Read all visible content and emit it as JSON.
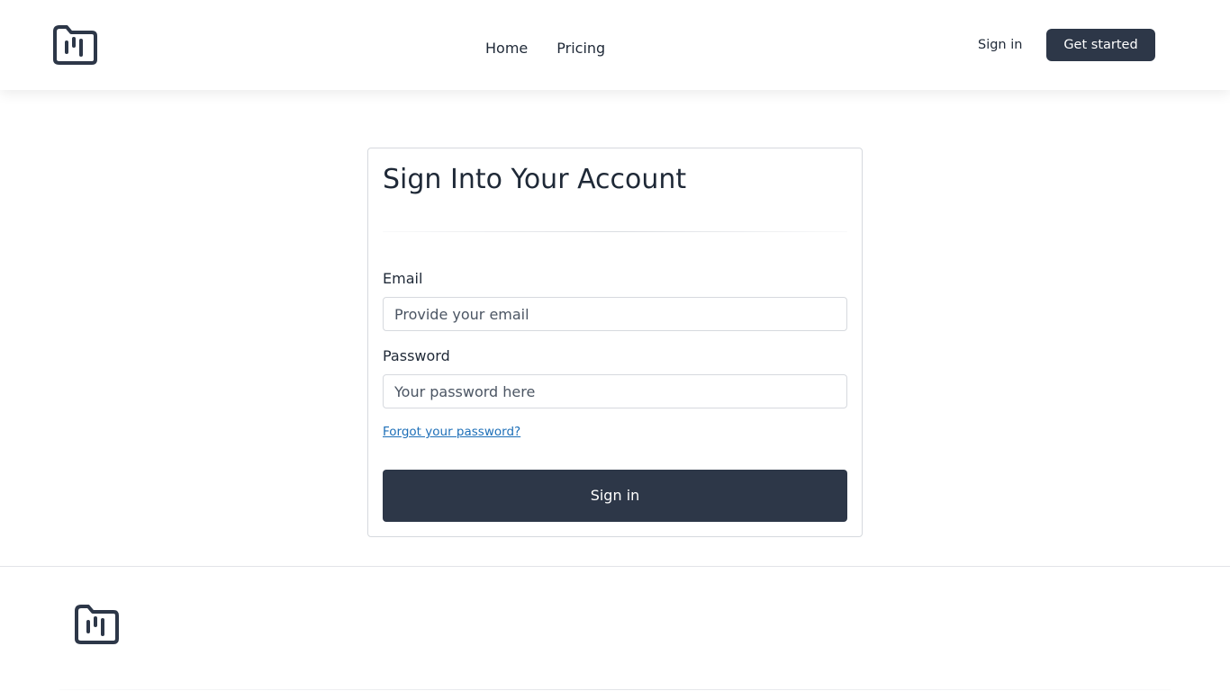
{
  "header": {
    "logo_icon": "folder-bars-icon",
    "nav": [
      {
        "label": "Home"
      },
      {
        "label": "Pricing"
      }
    ],
    "signin_label": "Sign in",
    "get_started_label": "Get started"
  },
  "form": {
    "title": "Sign Into Your Account",
    "email_label": "Email",
    "email_placeholder": "Provide your email",
    "email_value": "",
    "password_label": "Password",
    "password_placeholder": "Your password here",
    "password_value": "",
    "forgot_label": "Forgot your password?",
    "submit_label": "Sign in"
  },
  "footer": {
    "logo_icon": "folder-bars-icon"
  },
  "colors": {
    "primary": "#2d3748",
    "link": "#1d6fb8",
    "border": "#d6d9de",
    "text": "#1f2937"
  }
}
